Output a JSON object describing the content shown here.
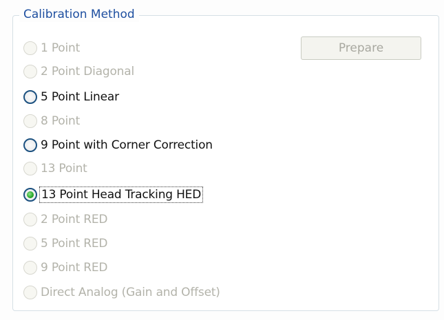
{
  "group": {
    "title": "Calibration Method"
  },
  "prepare_button": {
    "label": "Prepare",
    "enabled": false
  },
  "options": [
    {
      "label": "1 Point",
      "enabled": false,
      "selected": false
    },
    {
      "label": "2 Point Diagonal",
      "enabled": false,
      "selected": false
    },
    {
      "label": "5 Point Linear",
      "enabled": true,
      "selected": false
    },
    {
      "label": "8 Point",
      "enabled": false,
      "selected": false
    },
    {
      "label": "9 Point with Corner Correction",
      "enabled": true,
      "selected": false
    },
    {
      "label": "13 Point",
      "enabled": false,
      "selected": false
    },
    {
      "label": "13 Point Head Tracking HED",
      "enabled": true,
      "selected": true
    },
    {
      "label": "2 Point RED",
      "enabled": false,
      "selected": false
    },
    {
      "label": "5 Point RED",
      "enabled": false,
      "selected": false
    },
    {
      "label": "9 Point RED",
      "enabled": false,
      "selected": false
    },
    {
      "label": "Direct Analog (Gain and Offset)",
      "enabled": false,
      "selected": false
    }
  ],
  "colors": {
    "title": "#1e4fa0",
    "enabled_text": "#111111",
    "disabled_text": "#b3b3aa",
    "selected_dot": "#27a827"
  }
}
